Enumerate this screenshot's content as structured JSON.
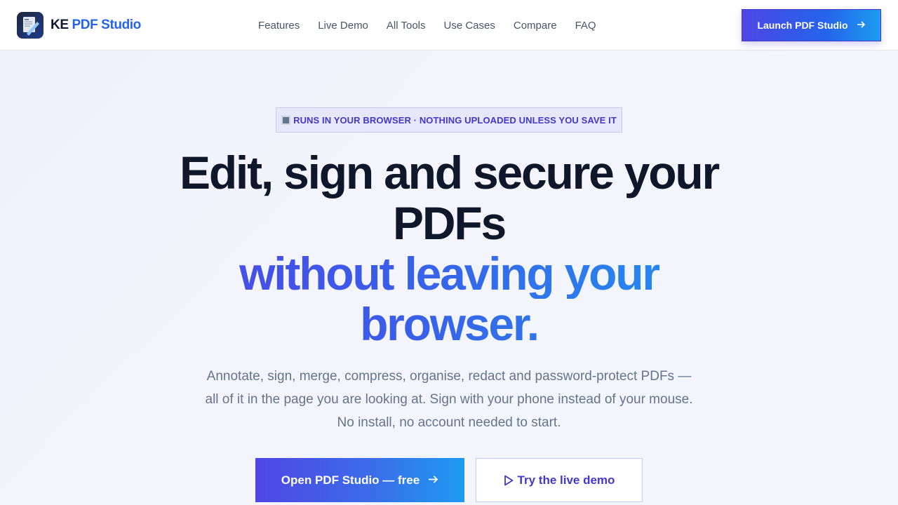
{
  "brand": {
    "name_prefix": "KE",
    "name_suffix": "PDF Studio",
    "logo_icon": "pdf-document-pen-icon"
  },
  "nav": {
    "items": [
      {
        "label": "Features"
      },
      {
        "label": "Live Demo"
      },
      {
        "label": "All Tools"
      },
      {
        "label": "Use Cases"
      },
      {
        "label": "Compare"
      },
      {
        "label": "FAQ"
      }
    ]
  },
  "header": {
    "launch_label": "Launch PDF Studio",
    "launch_icon": "arrow-right-icon"
  },
  "hero": {
    "badge": "RUNS IN YOUR BROWSER · NOTHING UPLOADED UNLESS YOU SAVE IT",
    "badge_icon": "square-icon",
    "headline_line1": "Edit, sign and secure your",
    "headline_line2": "PDFs",
    "headline_line3": "without leaving your",
    "headline_line4": "browser.",
    "subtitle": "Annotate, sign, merge, compress, organise, redact and password-protect PDFs — all of it in the page you are looking at. Sign with your phone instead of your mouse. No install, no account needed to start.",
    "cta_primary": "Open PDF Studio — free",
    "cta_primary_icon": "arrow-right-icon",
    "cta_secondary": "Try the live demo",
    "cta_secondary_icon": "play-icon"
  },
  "colors": {
    "accent_indigo": "#4f46e5",
    "accent_blue": "#1d9bf0",
    "text_dark": "#0f172a",
    "text_muted": "#64748b"
  }
}
